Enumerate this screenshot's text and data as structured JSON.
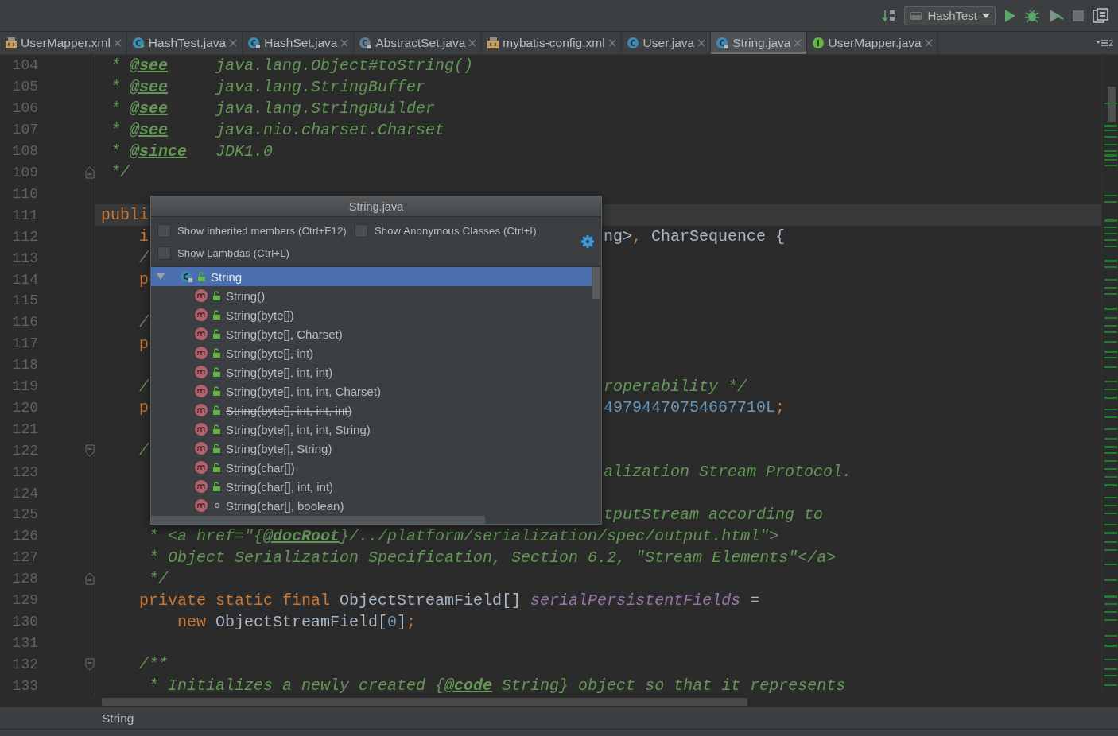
{
  "toolbar": {
    "run_config": "HashTest"
  },
  "tabs": [
    {
      "label": "UserMapper.xml",
      "kind": "xml",
      "selected": false
    },
    {
      "label": "HashTest.java",
      "kind": "runnable",
      "selected": false
    },
    {
      "label": "HashSet.java",
      "kind": "locked",
      "selected": false
    },
    {
      "label": "AbstractSet.java",
      "kind": "abstract",
      "selected": false
    },
    {
      "label": "mybatis-config.xml",
      "kind": "xml",
      "selected": false
    },
    {
      "label": "User.java",
      "kind": "class",
      "selected": false
    },
    {
      "label": "String.java",
      "kind": "locked",
      "selected": true
    },
    {
      "label": "UserMapper.java",
      "kind": "interface",
      "selected": false
    }
  ],
  "tab_overflow_count": "2",
  "editor": {
    "lines": [
      {
        "number": "104",
        "current": false,
        "tokens": [
          {
            "text": " * ",
            "kind": "doc"
          },
          {
            "text": "@see",
            "kind": "tag"
          },
          {
            "text": "     java.lang.Object",
            "kind": "doc"
          },
          {
            "text": "#toString()",
            "kind": "doc"
          }
        ]
      },
      {
        "number": "105",
        "current": false,
        "tokens": [
          {
            "text": " * ",
            "kind": "doc"
          },
          {
            "text": "@see",
            "kind": "tag"
          },
          {
            "text": "     java.lang.StringBuffer",
            "kind": "doc"
          }
        ]
      },
      {
        "number": "106",
        "current": false,
        "tokens": [
          {
            "text": " * ",
            "kind": "doc"
          },
          {
            "text": "@see",
            "kind": "tag"
          },
          {
            "text": "     java.lang.StringBuilder",
            "kind": "doc"
          }
        ]
      },
      {
        "number": "107",
        "current": false,
        "tokens": [
          {
            "text": " * ",
            "kind": "doc"
          },
          {
            "text": "@see",
            "kind": "tag"
          },
          {
            "text": "     java.nio.charset.Charset",
            "kind": "doc"
          }
        ]
      },
      {
        "number": "108",
        "current": false,
        "tokens": [
          {
            "text": " * ",
            "kind": "doc"
          },
          {
            "text": "@since",
            "kind": "tag"
          },
          {
            "text": "   JDK1.0",
            "kind": "doc"
          }
        ]
      },
      {
        "number": "109",
        "current": false,
        "kind": "foldend",
        "tokens": [
          {
            "text": " */",
            "kind": "doc"
          }
        ]
      },
      {
        "number": "110",
        "current": false
      },
      {
        "number": "111",
        "current": true,
        "left": [
          {
            "text": "publi",
            "kind": "keyword"
          }
        ]
      },
      {
        "number": "112",
        "current": false,
        "left": [
          {
            "text": "    i",
            "kind": "keyword"
          }
        ],
        "right": [
          {
            "text": "ng>",
            "kind": "plain"
          },
          {
            "text": ",",
            "kind": "punct"
          },
          {
            "text": " CharSequence {",
            "kind": "plain"
          }
        ]
      },
      {
        "number": "113",
        "current": false,
        "left": [
          {
            "text": "    /",
            "kind": "comment"
          }
        ]
      },
      {
        "number": "114",
        "current": false,
        "left": [
          {
            "text": "    p",
            "kind": "keyword"
          }
        ]
      },
      {
        "number": "115",
        "current": false
      },
      {
        "number": "116",
        "current": false,
        "left": [
          {
            "text": "    /",
            "kind": "comment"
          }
        ]
      },
      {
        "number": "117",
        "current": false,
        "left": [
          {
            "text": "    p",
            "kind": "keyword"
          }
        ]
      },
      {
        "number": "118",
        "current": false
      },
      {
        "number": "119",
        "current": false,
        "left": [
          {
            "text": "    /",
            "kind": "doc"
          }
        ],
        "right": [
          {
            "text": "roperability */",
            "kind": "doc"
          }
        ]
      },
      {
        "number": "120",
        "current": false,
        "left": [
          {
            "text": "    p",
            "kind": "keyword"
          }
        ],
        "right": [
          {
            "text": "49794470754667710L",
            "kind": "number"
          },
          {
            "text": ";",
            "kind": "punct"
          }
        ]
      },
      {
        "number": "121",
        "current": false
      },
      {
        "number": "122",
        "current": false,
        "kind": "foldstart",
        "left": [
          {
            "text": "    /",
            "kind": "doc"
          }
        ]
      },
      {
        "number": "123",
        "current": false,
        "right": [
          {
            "text": "alization Stream Protocol.",
            "kind": "doc"
          }
        ]
      },
      {
        "number": "124",
        "current": false
      },
      {
        "number": "125",
        "current": false,
        "right": [
          {
            "text": "tputStream according to",
            "kind": "doc"
          }
        ]
      },
      {
        "number": "126",
        "current": false,
        "tokens": [
          {
            "text": "     * <a href=\"{",
            "kind": "doc"
          },
          {
            "text": "@docRoot",
            "kind": "tag"
          },
          {
            "text": "}/../platform/serialization/spec/output.html\">",
            "kind": "doc"
          }
        ]
      },
      {
        "number": "127",
        "current": false,
        "tokens": [
          {
            "text": "     * Object Serialization Specification, Section 6.2, \"Stream Elements\"</a>",
            "kind": "doc"
          }
        ]
      },
      {
        "number": "128",
        "current": false,
        "kind": "foldend",
        "tokens": [
          {
            "text": "     */",
            "kind": "doc"
          }
        ]
      },
      {
        "number": "129",
        "current": false,
        "tokens": [
          {
            "text": "    private static final ",
            "kind": "keyword"
          },
          {
            "text": "ObjectStreamField[] ",
            "kind": "plain"
          },
          {
            "text": "serialPersistentFields",
            "kind": "field"
          },
          {
            "text": " =",
            "kind": "plain"
          }
        ]
      },
      {
        "number": "130",
        "current": false,
        "tokens": [
          {
            "text": "        new ",
            "kind": "keyword"
          },
          {
            "text": "ObjectStreamField[",
            "kind": "plain"
          },
          {
            "text": "0",
            "kind": "number"
          },
          {
            "text": "]",
            "kind": "plain"
          },
          {
            "text": ";",
            "kind": "punct"
          }
        ]
      },
      {
        "number": "131",
        "current": false
      },
      {
        "number": "132",
        "current": false,
        "kind": "foldstart",
        "tokens": [
          {
            "text": "    /**",
            "kind": "doc"
          }
        ]
      },
      {
        "number": "133",
        "current": false,
        "tokens": [
          {
            "text": "     * Initializes a newly created {",
            "kind": "doc"
          },
          {
            "text": "@code",
            "kind": "tag"
          },
          {
            "text": " String} object so that it represents",
            "kind": "doc"
          }
        ]
      }
    ]
  },
  "structure_popup": {
    "title": "String.java",
    "options": [
      {
        "label": "Show inherited members (Ctrl+F12)",
        "checked": false
      },
      {
        "label": "Show Anonymous Classes (Ctrl+I)",
        "checked": false
      },
      {
        "label": "Show Lambdas (Ctrl+L)",
        "checked": false
      }
    ],
    "tree": {
      "label": "String",
      "expanded": true,
      "selected": true,
      "children": [
        {
          "label": "String()",
          "deprecated": false,
          "kind": "public",
          "selected": false
        },
        {
          "label": "String(byte[])",
          "deprecated": false,
          "kind": "public",
          "selected": false
        },
        {
          "label": "String(byte[], Charset)",
          "deprecated": false,
          "kind": "public",
          "selected": false
        },
        {
          "label": "String(byte[], int)",
          "deprecated": true,
          "kind": "public",
          "selected": false
        },
        {
          "label": "String(byte[], int, int)",
          "deprecated": false,
          "kind": "public",
          "selected": false
        },
        {
          "label": "String(byte[], int, int, Charset)",
          "deprecated": false,
          "kind": "public",
          "selected": false
        },
        {
          "label": "String(byte[], int, int, int)",
          "deprecated": true,
          "kind": "public",
          "selected": false
        },
        {
          "label": "String(byte[], int, int, String)",
          "deprecated": false,
          "kind": "public",
          "selected": false
        },
        {
          "label": "String(byte[], String)",
          "deprecated": false,
          "kind": "public",
          "selected": false
        },
        {
          "label": "String(char[])",
          "deprecated": false,
          "kind": "public",
          "selected": false
        },
        {
          "label": "String(char[], int, int)",
          "deprecated": false,
          "kind": "public",
          "selected": false
        },
        {
          "label": "String(char[], boolean)",
          "deprecated": false,
          "kind": "package",
          "selected": false
        }
      ]
    }
  },
  "status_bar": {
    "text": "String"
  }
}
